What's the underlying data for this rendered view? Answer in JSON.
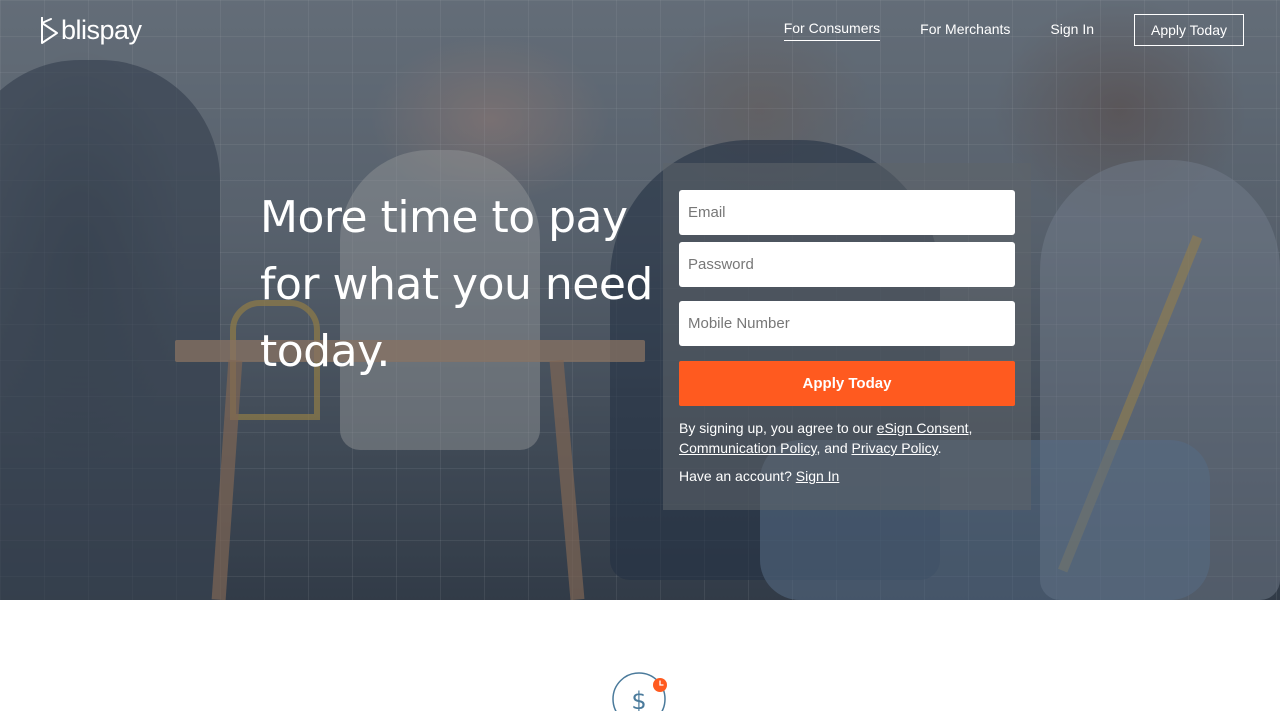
{
  "brand": {
    "name": "blispay"
  },
  "nav": {
    "consumers": "For Consumers",
    "merchants": "For Merchants",
    "sign_in": "Sign In",
    "apply": "Apply Today"
  },
  "hero": {
    "headline": "More time to pay for what you need today."
  },
  "form": {
    "email_placeholder": "Email",
    "password_placeholder": "Password",
    "mobile_placeholder": "Mobile Number",
    "submit_label": "Apply Today",
    "legal_prefix": "By signing up, you agree to our ",
    "esign_link": "eSign Consent",
    "comma": ",",
    "communication_link": "Communication Policy",
    "and_text": ", and ",
    "privacy_link": "Privacy Policy",
    "period": ".",
    "account_prompt": "Have an account? ",
    "sign_in_link": "Sign In"
  },
  "icons": {
    "feature_icon": "dollar-clock-icon"
  },
  "colors": {
    "accent": "#ff5a1f",
    "icon_stroke": "#4a7a9b"
  }
}
